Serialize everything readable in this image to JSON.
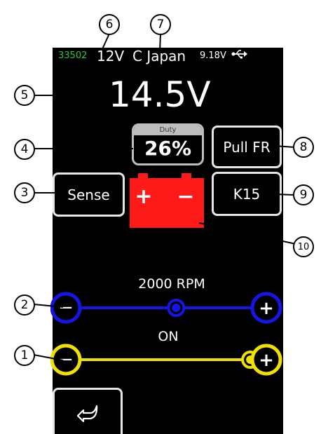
{
  "status_bar": {
    "code": "33502",
    "system_voltage": "12V",
    "region": "C Japan",
    "battery": "9.18V"
  },
  "main_voltage": "14.5V",
  "duty": {
    "label": "Duty",
    "value": "26%"
  },
  "buttons": {
    "pull_fr": "Pull FR",
    "sense": "Sense",
    "k15": "K15"
  },
  "battery_icon": {
    "plus": "+",
    "minus": "−",
    "color": "#ff1a1a"
  },
  "rpm": {
    "label": "2000 RPM",
    "level": 0.55,
    "color": "#1515e6"
  },
  "switch": {
    "label": "ON",
    "level": 0.92,
    "color": "#f0e000"
  },
  "controls": {
    "minus": "−",
    "plus": "+"
  },
  "callouts": [
    "1",
    "2",
    "3",
    "4",
    "5",
    "6",
    "7",
    "8",
    "9",
    "10"
  ],
  "icons": {
    "usb": "usb-icon",
    "back": "back-arrow-icon"
  }
}
